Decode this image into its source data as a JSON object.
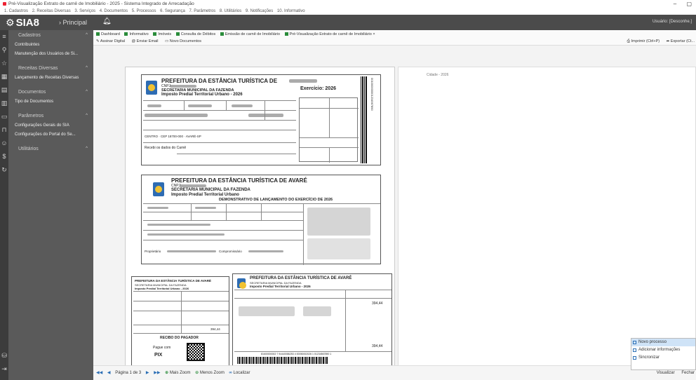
{
  "window": {
    "title": "Pré-Visualização Extrato de carnê de Imobiliário - 2025 - Sistema Integrado de Arrecadação",
    "controls": {
      "minimize": "–",
      "maximize": "▢"
    }
  },
  "menubar": {
    "items": [
      "1. Cadastros",
      "2. Receitas Diversas",
      "3. Serviços",
      "4. Documentos",
      "5. Processos",
      "6. Segurança",
      "7. Parâmetros",
      "8. Utilitários",
      "9. Notificações",
      "10. Informativo"
    ]
  },
  "header": {
    "logo": "SIA8",
    "breadcrumb": "› Principal",
    "user": "Usuário: [Desconhe.]"
  },
  "sidebar": {
    "sections": [
      {
        "title": "Cadastros",
        "items": [
          "Contribuintes",
          "Manutenção dos Usuários de Si..."
        ]
      },
      {
        "title": "Receitas Diversas",
        "items": [
          "Lançamento de Receitas Diversas"
        ]
      },
      {
        "title": "Documentos",
        "items": [
          "Tipo de Documentos"
        ]
      },
      {
        "title": "Parâmetros",
        "items": [
          "Configurações Gerais do SIA",
          "Configurações do Portal do Se..."
        ]
      },
      {
        "title": "Utilitários",
        "items": []
      }
    ]
  },
  "tabs": {
    "items": [
      "Dashboard",
      "Informativo",
      "Imóveis",
      "Consulta de Débitos",
      "Emissão de carnê de Imobiliário",
      "Pré-Visualização Extrato de carnê de Imobiliário"
    ],
    "close": "×"
  },
  "actions": {
    "left": [
      "Assinar Digital",
      "Enviar Email",
      "Novo Documentos"
    ],
    "right": [
      "Imprimir (Ctrl+P)",
      "Exportar (Ct..."
    ]
  },
  "document": {
    "page2_label": "Cidade - 2026",
    "block1": {
      "city": "PREFEITURA DA ESTÂNCIA TURÍSTICA DE",
      "cnpj": "CNPJ:",
      "dept": "SECRETARIA MUNICIPAL DA FAZENDA",
      "tax": "Imposto Predial Territorial Urbano - 2026",
      "exercise": "Exercício: 2026",
      "side_code": "001000000001234567890",
      "address": "CENTRO · CEP 18700-000 · AVARÉ-SP",
      "receipt": "Recebi os dados do Carnê"
    },
    "block2": {
      "city": "PREFEITURA DA ESTÂNCIA TURÍSTICA DE AVARÉ",
      "cnpj": "CNPJ:",
      "dept": "SECRETARIA MUNICIPAL DA FAZENDA",
      "tax": "Imposto Predial Territorial Urbano",
      "demo": "DEMONSTRATIVO DE LANÇAMENTO DO EXERCÍCIO DE 2026",
      "owner_label": "Proprietário",
      "compromissario_label": "Compromissário"
    },
    "block3": {
      "left_title": "PREFEITURA DA ESTÂNCIA TURÍSTICA DE AVARÉ",
      "left_dept": "SECRETARIA MUNICIPAL DA FAZENDA",
      "left_tax": "Imposto Predial Territorial Urbano - 2026",
      "value": "394,44",
      "receipt": "RECIBO DO PAGADOR",
      "pay_label": "Pague com",
      "pix": "PIX",
      "right_title": "PREFEITURA DA ESTÂNCIA TURÍSTICA DE AVARÉ",
      "right_dept": "SECRETARIA MUNICIPAL DA FAZENDA",
      "right_tax": "Imposto Predial Territorial Urbano - 2026",
      "right_value": "394,44",
      "right_value_bottom": "394,44",
      "barcode_digits": "81600000002 7 94440086253 4 00050002026 1 01234567890 1"
    }
  },
  "pager": {
    "first": "◀◀",
    "prev": "◀",
    "page_text": "Página 1 de 3",
    "next": "▶",
    "last": "▶▶",
    "zoom_in": "Mais Zoom",
    "zoom_out": "Menos Zoom",
    "search": "Localizar"
  },
  "popup": {
    "items": [
      "Novo processo",
      "Adicionar informações",
      "Sincronizar"
    ],
    "selected_index": 0
  },
  "bottom_right": {
    "item1": "Visualizar",
    "item2": "Fechar"
  }
}
